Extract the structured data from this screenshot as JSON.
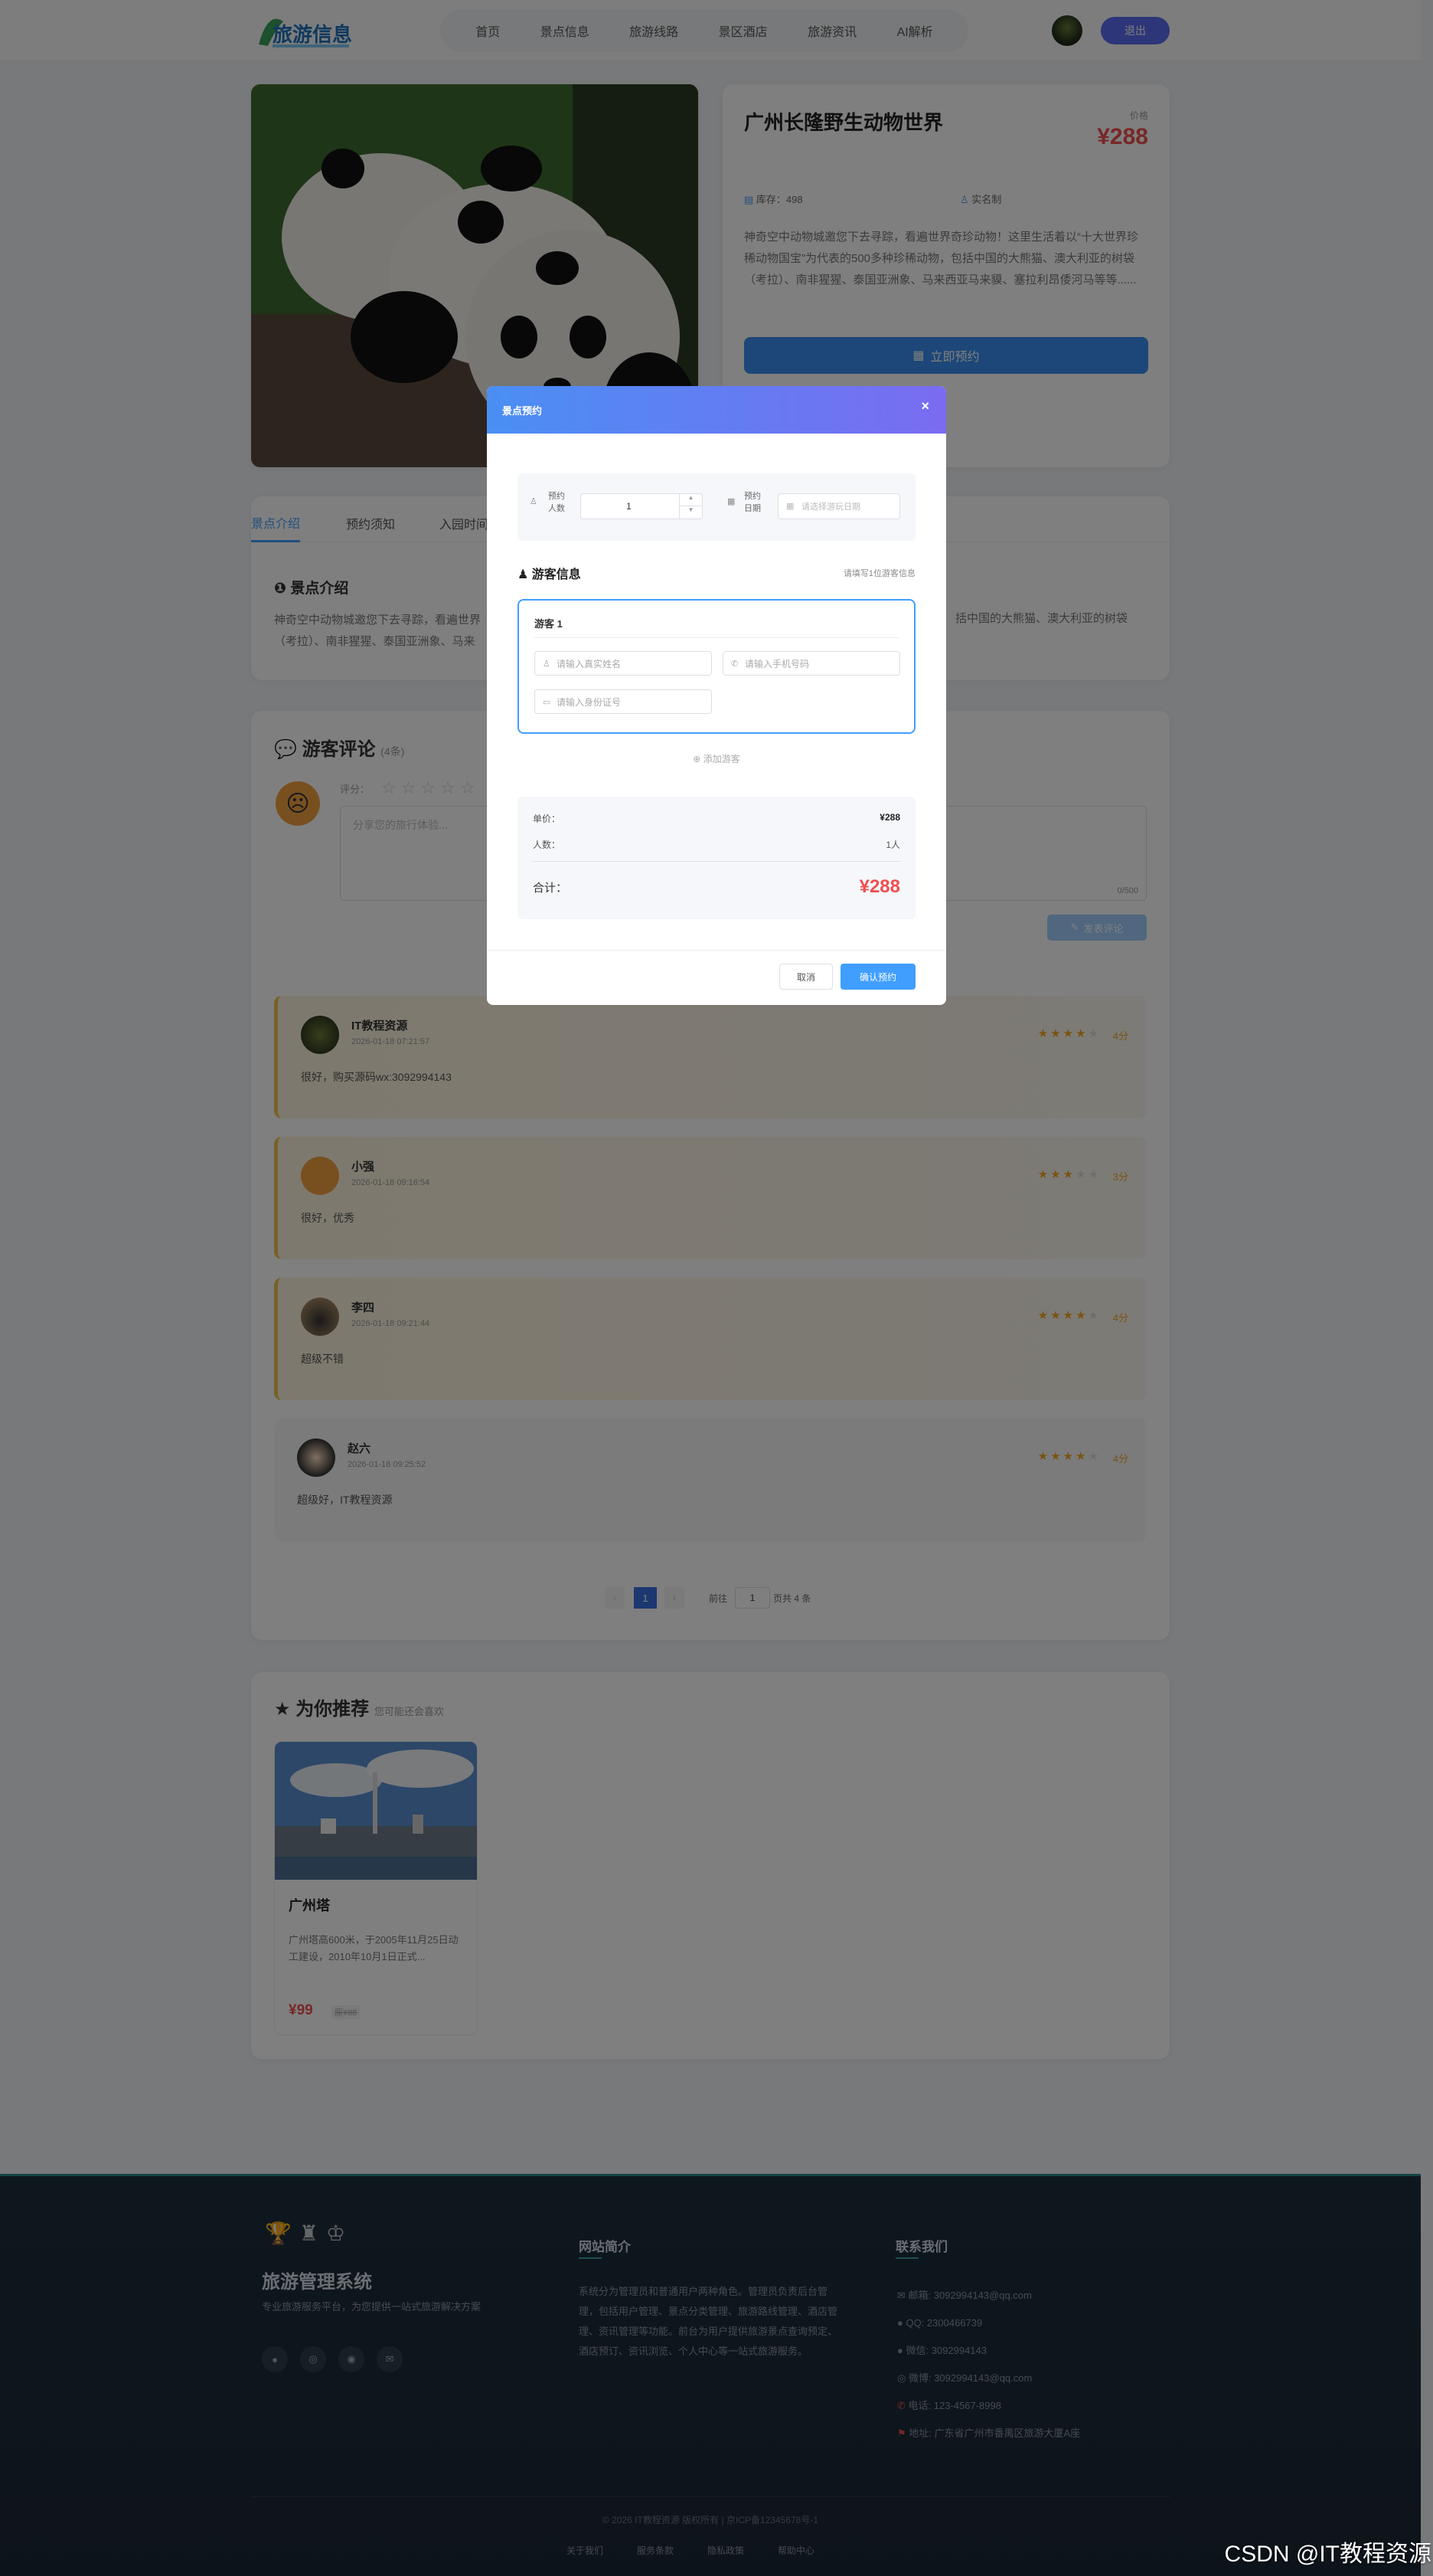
{
  "header": {
    "logo_text": "旅游信息",
    "nav": [
      "首页",
      "景点信息",
      "旅游线路",
      "景区酒店",
      "旅游资讯",
      "AI解析"
    ],
    "logout": "退出"
  },
  "attraction": {
    "name": "广州长隆野生动物世界",
    "price_label": "价格",
    "price": "¥288",
    "stock": "库存：498",
    "realname": "实名制",
    "desc": "神奇空中动物城邀您下去寻踪，看遍世界奇珍动物！这里生活着以“十大世界珍稀动物国宝”为代表的500多种珍稀动物，包括中国的大熊猫、澳大利亚的树袋（考拉）、南非猩猩、泰国亚洲象、马来西亚马来貘、塞拉利昂倭河马等等......",
    "book_btn": "立即预约"
  },
  "tabs": {
    "items": [
      "景点介绍",
      "预约须知",
      "入园时间"
    ],
    "section_title": "景点介绍",
    "text_left": "神奇空中动物城邀您下去寻踪，看遍世界",
    "text_left2": "（考拉）、南非猩猩、泰国亚洲象、马来",
    "text_right": "括中国的大熊猫、澳大利亚的树袋"
  },
  "comments": {
    "title": "游客评论",
    "count": "(4条)",
    "rating_label": "评分：",
    "placeholder": "分享您的旅行体验...",
    "counter": "0/500",
    "submit": "发表评论",
    "items": [
      {
        "user": "IT教程资源",
        "time": "2026-01-18 07:21:57",
        "text": "很好，购买源码wx:3092994143",
        "stars": 4,
        "score": "4分"
      },
      {
        "user": "小强",
        "time": "2026-01-18 09:16:54",
        "text": "很好，优秀",
        "stars": 3,
        "score": "3分"
      },
      {
        "user": "李四",
        "time": "2026-01-18 09:21:44",
        "text": "超级不错",
        "stars": 4,
        "score": "4分"
      },
      {
        "user": "赵六",
        "time": "2026-01-18 09:25:52",
        "text": "超级好，IT教程资源",
        "stars": 4,
        "score": "4分"
      }
    ],
    "pager": {
      "current": "1",
      "goto_label": "前往",
      "goto_value": "1",
      "pages_label": "页共 4 条"
    }
  },
  "recommend": {
    "title": "为你推荐",
    "subtitle": "您可能还会喜欢",
    "card": {
      "name": "广州塔",
      "desc": "广州塔高600米，于2005年11月25日动工建设，2010年10月1日正式...",
      "price": "¥99",
      "old_price": "原¥88"
    }
  },
  "footer": {
    "brand": "旅游管理系统",
    "tagline": "专业旅游服务平台，为您提供一站式旅游解决方案",
    "about_title": "网站简介",
    "about_text": "系统分为管理员和普通用户两种角色。管理员负责后台管理，包括用户管理、景点分类管理、旅游路线管理、酒店管理、资讯管理等功能。前台为用户提供旅游景点查询预定、酒店预订、资讯浏览、个人中心等一站式旅游服务。",
    "contact_title": "联系我们",
    "contacts": [
      "邮箱: 3092994143@qq.com",
      "QQ: 2300466739",
      "微信: 3092994143",
      "微博: 3092994143@qq.com",
      "电话: 123-4567-8998",
      "地址: 广东省广州市番禺区旅游大厦A座"
    ],
    "copyright": "© 2026 IT教程资源 版权所有 | 京ICP备12345678号-1",
    "links": [
      "关于我们",
      "服务条款",
      "隐私政策",
      "帮助中心"
    ],
    "watermark": "CSDN @IT教程资源"
  },
  "modal": {
    "title": "景点预约",
    "people_label": "预约人数",
    "people_value": "1",
    "date_label": "预约日期",
    "date_placeholder": "请选择游玩日期",
    "visitor_title": "游客信息",
    "visitor_hint": "请填写1位游客信息",
    "visitor_name": "游客 1",
    "name_placeholder": "请输入真实姓名",
    "phone_placeholder": "请输入手机号码",
    "id_placeholder": "请输入身份证号",
    "add_visitor": "添加游客",
    "unit_label": "单价：",
    "unit_value": "¥288",
    "count_label": "人数：",
    "count_value": "1人",
    "total_label": "合计：",
    "total_value": "¥288",
    "cancel": "取消",
    "confirm": "确认预约"
  },
  "colors": {
    "accent": "#409eff",
    "price": "#f04e4e",
    "brand": "#5b6cf0"
  }
}
